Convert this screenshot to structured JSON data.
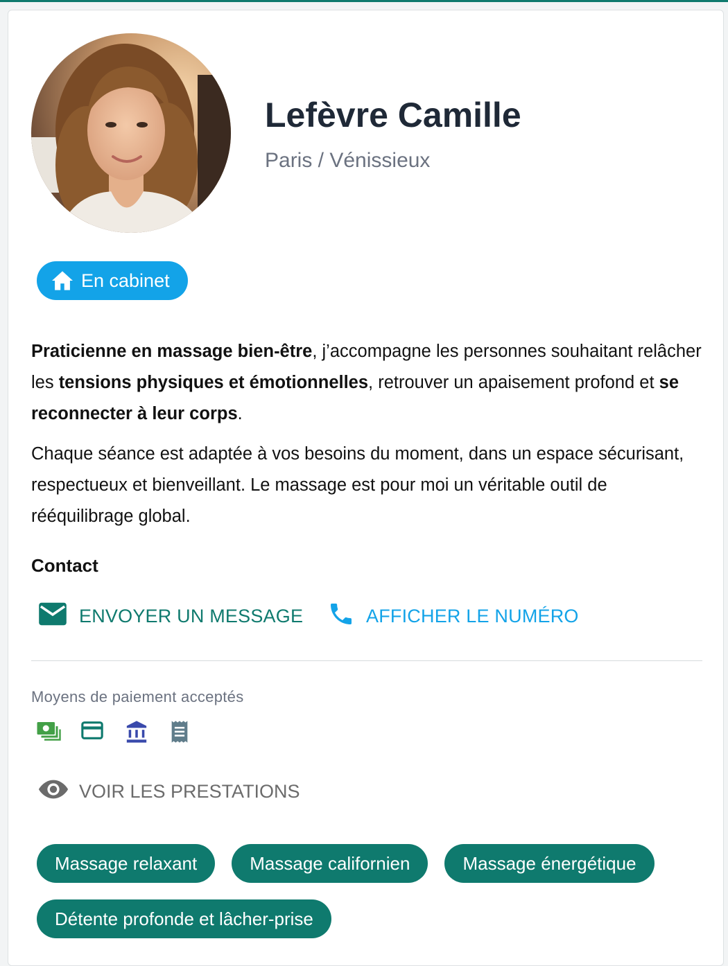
{
  "profile": {
    "name": "Lefèvre Camille",
    "location": "Paris / Vénissieux",
    "mode_label": "En cabinet"
  },
  "bio": {
    "p1": [
      {
        "text": "Praticienne en massage bien-être",
        "bold": true
      },
      {
        "text": ", j’accompagne les personnes souhaitant relâcher les ",
        "bold": false
      },
      {
        "text": "tensions physiques et émotionnelles",
        "bold": true
      },
      {
        "text": ", retrouver un apaisement profond et ",
        "bold": false
      },
      {
        "text": "se reconnecter à leur corps",
        "bold": true
      },
      {
        "text": ".",
        "bold": false
      }
    ],
    "p2": "Chaque séance est adaptée à vos besoins du moment, dans un espace sécurisant, respectueux et bienveillant. Le massage est pour moi un véritable outil de rééquilibrage global."
  },
  "contact": {
    "title": "Contact",
    "message_label": "ENVOYER UN MESSAGE",
    "phone_label": "AFFICHER LE NUMÉRO"
  },
  "payment": {
    "title": "Moyens de paiement acceptés",
    "methods": [
      "cash-icon",
      "credit-card-icon",
      "bank-transfer-icon",
      "cheque-icon"
    ]
  },
  "services": {
    "toggle_label": "VOIR LES PRESTATIONS",
    "items": [
      "Massage relaxant",
      "Massage californien",
      "Massage énergétique",
      "Détente profonde et lâcher-prise"
    ]
  },
  "colors": {
    "teal": "#0f7a6e",
    "blue": "#13a3e8",
    "bank_icon": "#3949ab",
    "cash_icon": "#43a047",
    "cheque_icon": "#607d8b"
  }
}
